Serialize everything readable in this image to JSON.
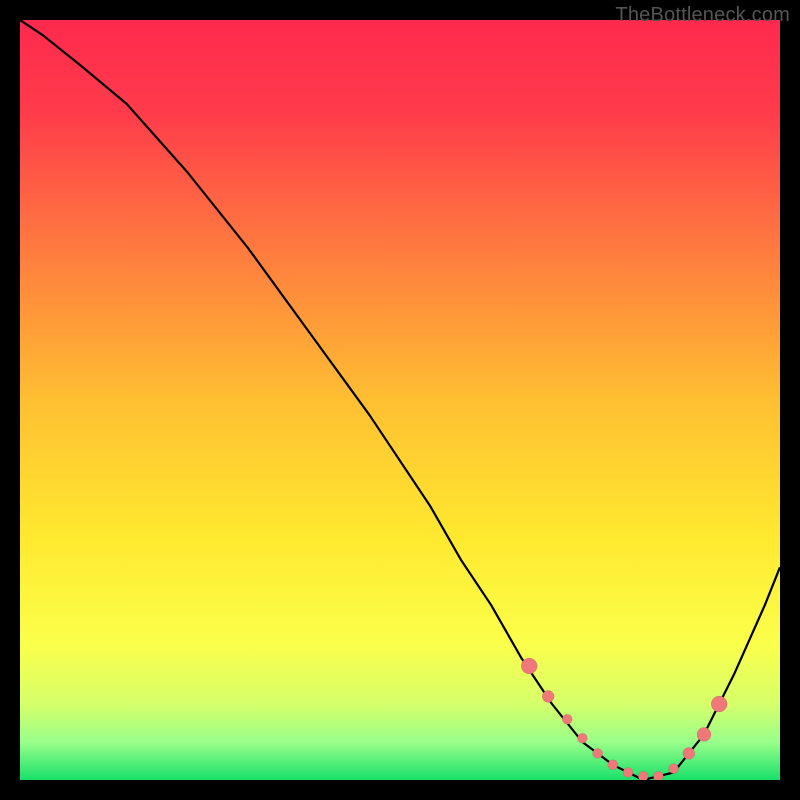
{
  "watermark": "TheBottleneck.com",
  "colors": {
    "background": "#000000",
    "curve": "#000000",
    "marker": "#f07878",
    "gradient_top": "#ff2a4d",
    "gradient_bottom": "#18e06a"
  },
  "chart_data": {
    "type": "line",
    "title": "",
    "xlabel": "",
    "ylabel": "",
    "xlim": [
      0,
      100
    ],
    "ylim": [
      0,
      100
    ],
    "x": [
      0,
      3,
      8,
      14,
      22,
      30,
      38,
      46,
      54,
      58,
      62,
      66,
      70,
      74,
      78,
      82,
      86,
      90,
      94,
      98,
      100
    ],
    "values": [
      0,
      2,
      6,
      11,
      20,
      30,
      41,
      52,
      64,
      71,
      77,
      84,
      90,
      95,
      98,
      100,
      99,
      94,
      86,
      77,
      72
    ],
    "series": [
      {
        "name": "curve",
        "x": [
          0,
          3,
          8,
          14,
          22,
          30,
          38,
          46,
          54,
          58,
          62,
          66,
          70,
          74,
          78,
          82,
          86,
          90,
          94,
          98,
          100
        ],
        "y": [
          0,
          2,
          6,
          11,
          20,
          30,
          41,
          52,
          64,
          71,
          77,
          84,
          90,
          95,
          98,
          100,
          99,
          94,
          86,
          77,
          72
        ]
      },
      {
        "name": "markers",
        "x": [
          67,
          69.5,
          72,
          74,
          76,
          78,
          80,
          82,
          84,
          86,
          88,
          90,
          92
        ],
        "y": [
          85,
          89,
          92,
          94.5,
          96.5,
          98,
          99,
          99.5,
          99.5,
          98.5,
          96.5,
          94,
          90
        ],
        "size": [
          8,
          6,
          5,
          5,
          5,
          5,
          5,
          5,
          5,
          5,
          6,
          7,
          8
        ]
      }
    ]
  }
}
